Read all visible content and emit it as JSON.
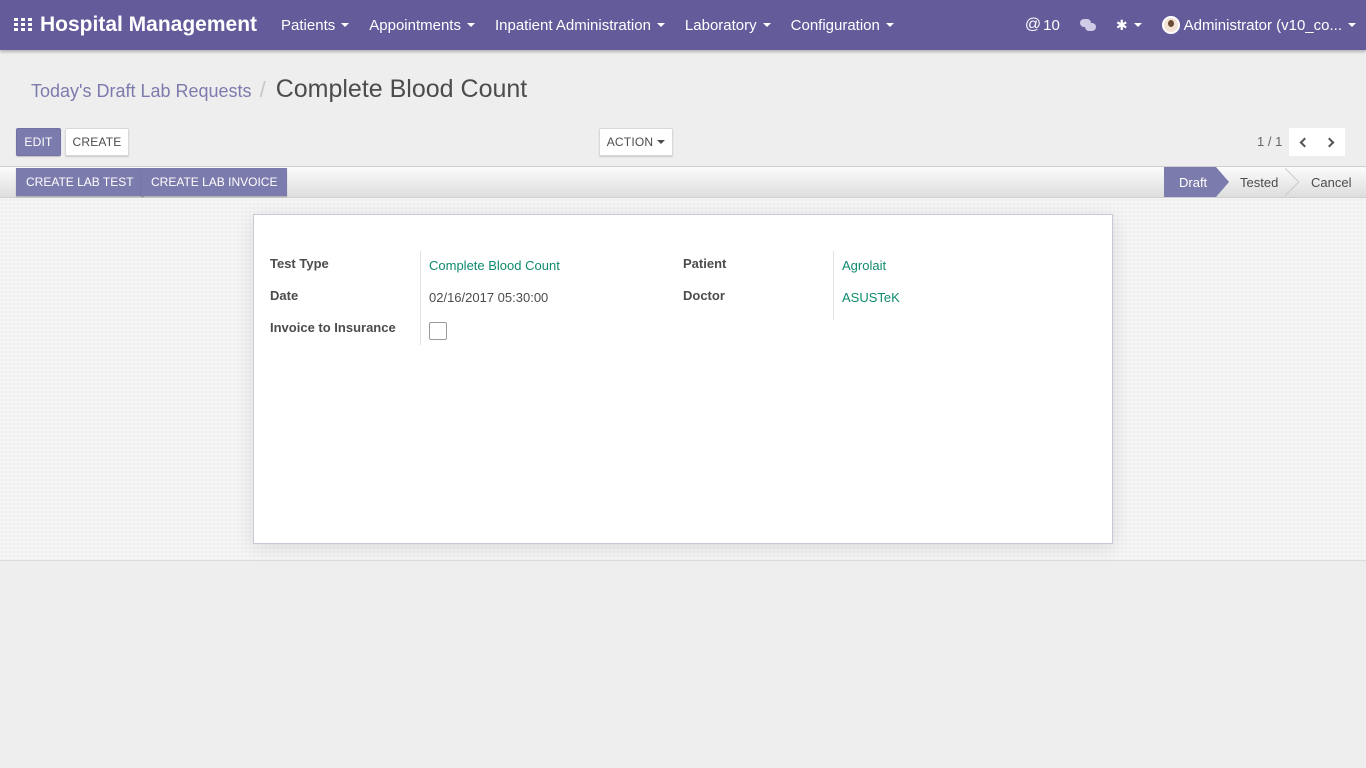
{
  "navbar": {
    "brand": "Hospital Management",
    "menus": [
      {
        "label": "Patients"
      },
      {
        "label": "Appointments"
      },
      {
        "label": "Inpatient Administration"
      },
      {
        "label": "Laboratory"
      },
      {
        "label": "Configuration"
      }
    ],
    "mentions_count": "10",
    "user_label": "Administrator (v10_co..."
  },
  "breadcrumb": {
    "parent": "Today's Draft Lab Requests",
    "separator": "/",
    "current": "Complete Blood Count"
  },
  "toolbar": {
    "edit_label": "EDIT",
    "create_label": "CREATE",
    "action_label": "ACTION"
  },
  "pager": {
    "value": "1 / 1"
  },
  "header_buttons": {
    "create_lab_test": "CREATE LAB TEST",
    "create_lab_invoice": "CREATE LAB INVOICE"
  },
  "statusbar": {
    "stages": [
      "Draft",
      "Tested",
      "Cancel"
    ],
    "active": "Draft"
  },
  "form": {
    "test_type_label": "Test Type",
    "test_type_value": "Complete Blood Count",
    "date_label": "Date",
    "date_value": "02/16/2017 05:30:00",
    "invoice_label": "Invoice to Insurance",
    "invoice_checked": false,
    "patient_label": "Patient",
    "patient_value": "Agrolait",
    "doctor_label": "Doctor",
    "doctor_value": "ASUSTeK"
  },
  "colors": {
    "navbar": "#635b9a",
    "primary": "#7c7bad",
    "link": "#0f8a6e"
  }
}
